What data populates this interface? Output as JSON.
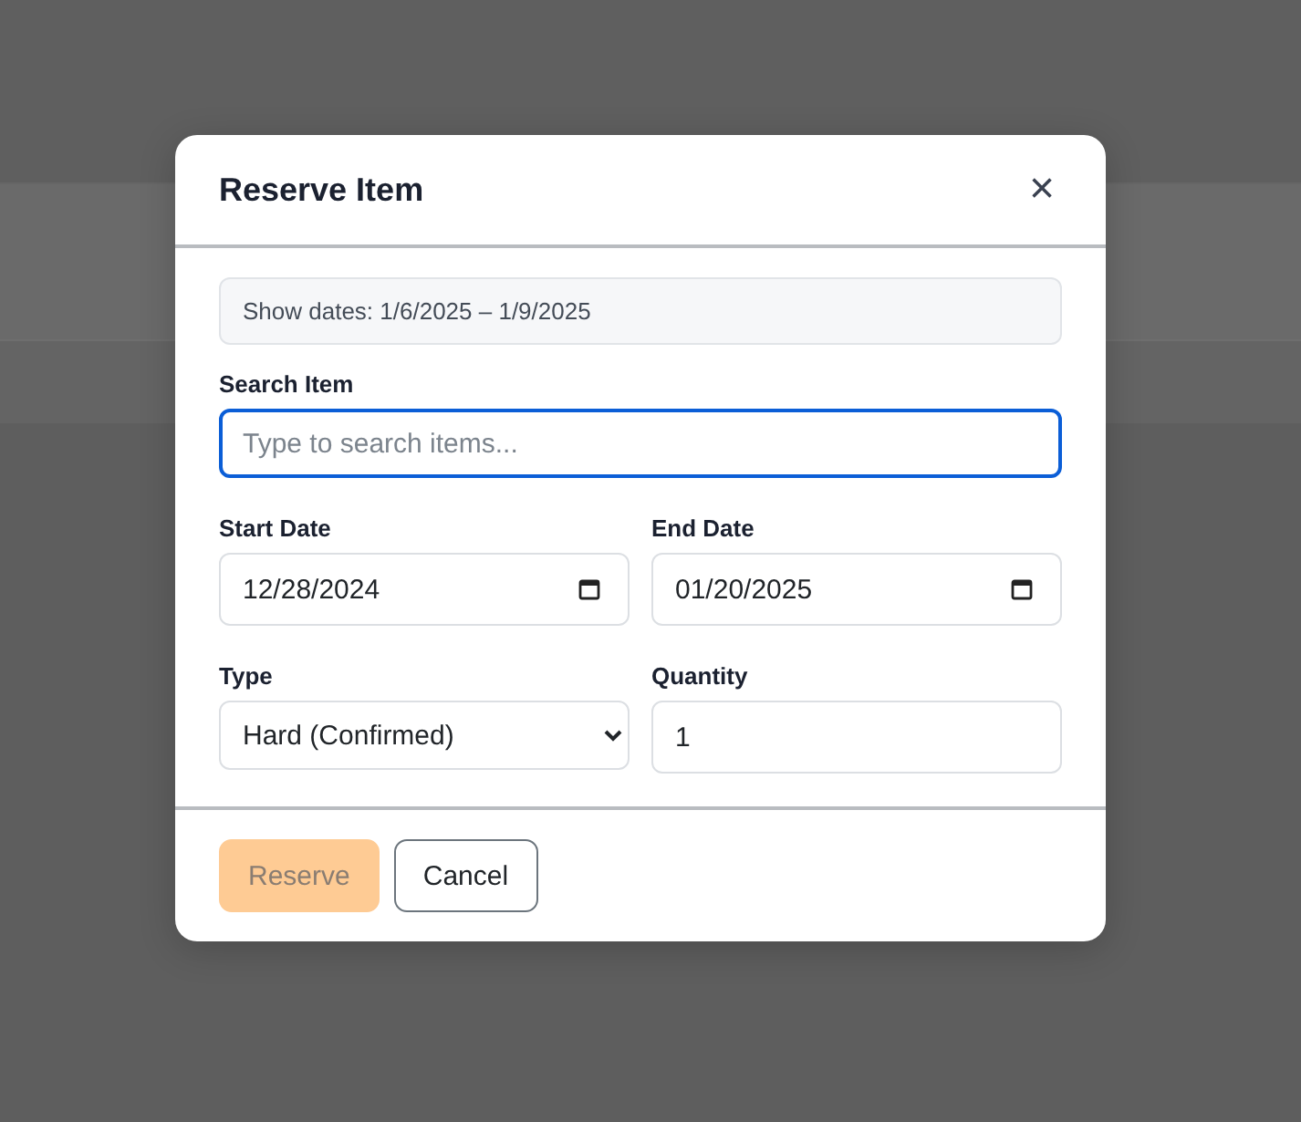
{
  "dialog": {
    "title": "Reserve Item",
    "close": "×",
    "notice": "Show dates: 1/6/2025 – 1/9/2025",
    "fields": [
      {
        "kind": "text",
        "label": "Search Item",
        "placeholder": "Type to search items...",
        "focused": true
      },
      {
        "kind": "date",
        "label": "Start Date",
        "value": "12/28/2024",
        "focused": false
      },
      {
        "kind": "date",
        "label": "End Date",
        "value": "01/20/2025",
        "focused": false
      },
      {
        "kind": "select",
        "label": "Type",
        "value": "Hard (Confirmed)",
        "focused": false
      },
      {
        "kind": "number",
        "label": "Quantity",
        "value": "1",
        "focused": false
      }
    ],
    "buttons": [
      {
        "kind": "primary",
        "label": "Reserve",
        "disabled": true
      },
      {
        "kind": "secondary",
        "label": "Cancel",
        "disabled": false
      }
    ]
  }
}
